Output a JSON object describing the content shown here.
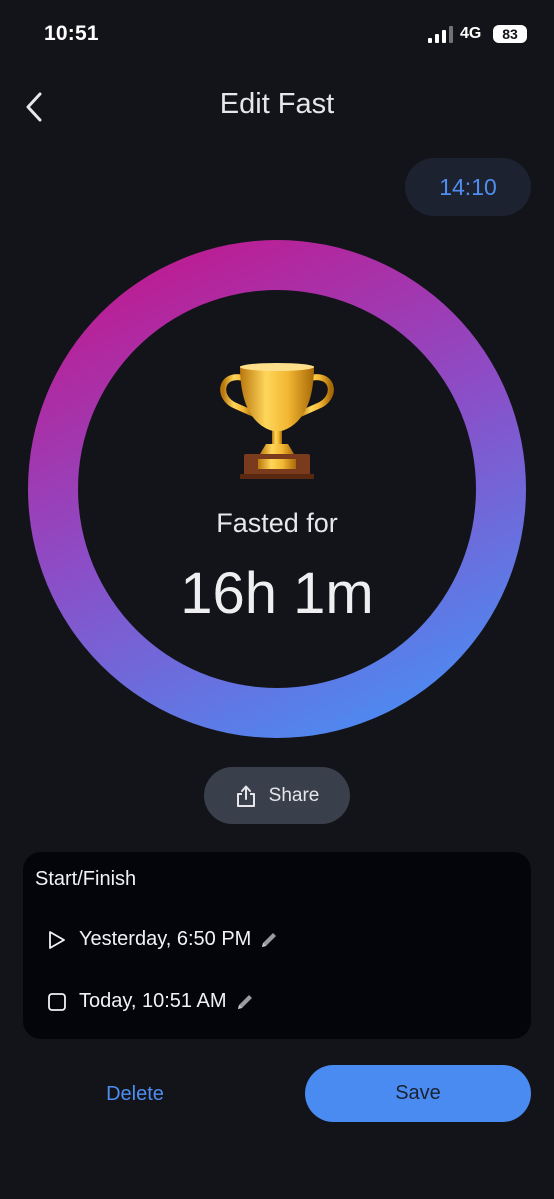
{
  "status_bar": {
    "time": "10:51",
    "network": "4G",
    "battery": "83"
  },
  "header": {
    "title": "Edit Fast"
  },
  "timer_pill": {
    "value": "14:10"
  },
  "progress_ring": {
    "progress_fraction": 1.0,
    "gradient_colors": [
      "#c0198f",
      "#8a4fc8",
      "#4b8cf2"
    ],
    "track_color": "#131419",
    "icon": "trophy-icon",
    "label": "Fasted for",
    "value": "16h 1m"
  },
  "share_button": {
    "label": "Share",
    "icon": "share-icon"
  },
  "start_finish": {
    "title": "Start/Finish",
    "start": {
      "icon": "play-icon",
      "text": "Yesterday, 6:50 PM",
      "edit_icon": "pencil-icon"
    },
    "finish": {
      "icon": "stop-icon",
      "text": "Today, 10:51 AM",
      "edit_icon": "pencil-icon"
    }
  },
  "actions": {
    "delete_label": "Delete",
    "save_label": "Save"
  },
  "colors": {
    "background": "#131419",
    "accent": "#4a8bf1",
    "card": "#03050b"
  }
}
